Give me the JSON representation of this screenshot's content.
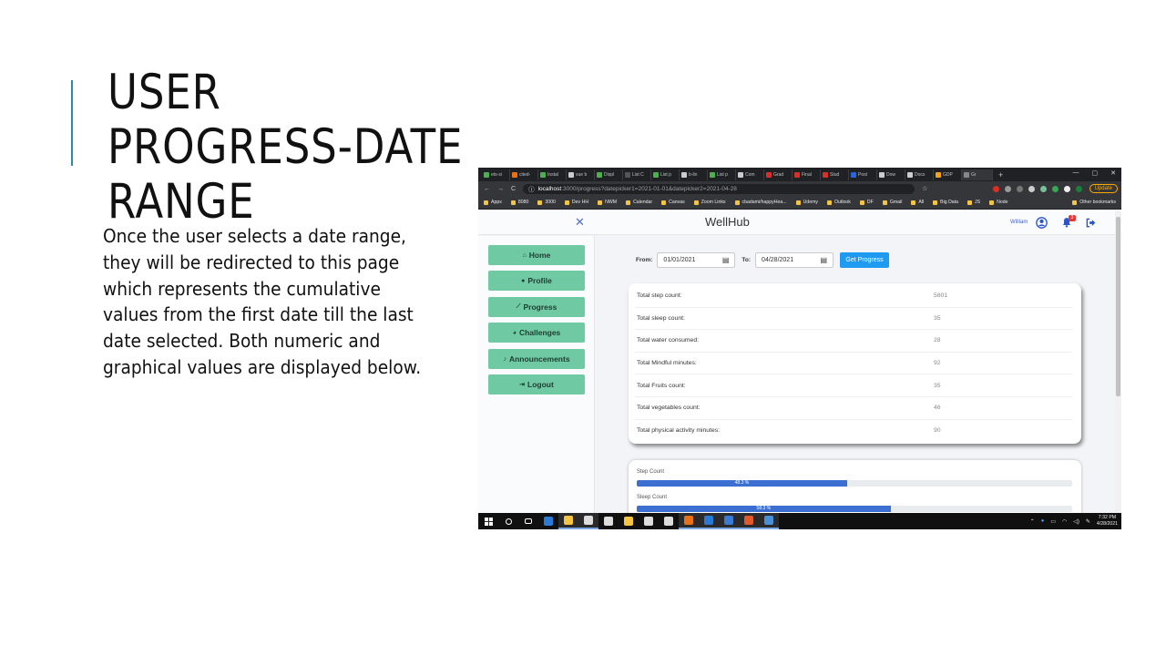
{
  "slide": {
    "title": "USER PROGRESS-DATE RANGE",
    "body": "Once the user selects a date range, they will be redirected to this page which represents the cumulative values from the first date till the last date selected. Both numeric and graphical values are displayed below."
  },
  "browser": {
    "tabs": [
      "ets-si",
      "cited-",
      "Instal",
      "vue b",
      "Displ",
      "List C",
      "List p",
      "b-lin",
      "List p",
      "Com",
      "Grad",
      "Final",
      "Stud",
      "Post",
      "Dow",
      "Docs",
      "GDP",
      "Gr"
    ],
    "url_host": "localhost",
    "url_path": ":3000/progress?datepicker1=2021-01-01&datepicker2=2021-04-28",
    "update_label": "Update",
    "bookmarks": [
      "Apps",
      "8080",
      "3000",
      "Dev HH",
      "NWM",
      "Calendar",
      "Canvas",
      "Zoom Links",
      "cbadami/happyHea...",
      "Udemy",
      "Outlook",
      "DF",
      "Gmail",
      "All",
      "Big Data",
      "JS",
      "Node"
    ],
    "other_bookmarks": "Other bookmarks"
  },
  "app": {
    "brand": "WellHub",
    "user_name": "William",
    "notification_count": "3",
    "nav": [
      {
        "label": "Home",
        "icon": "home-icon"
      },
      {
        "label": "Profile",
        "icon": "user-icon"
      },
      {
        "label": "Progress",
        "icon": "chart-line-icon"
      },
      {
        "label": "Challenges",
        "icon": "pie-chart-icon"
      },
      {
        "label": "Announcements",
        "icon": "bell-icon"
      },
      {
        "label": "Logout",
        "icon": "sign-out-icon"
      }
    ],
    "filter": {
      "from_label": "From:",
      "from_value": "01/01/2021",
      "to_label": "To:",
      "to_value": "04/28/2021",
      "button": "Get Progress"
    },
    "totals": [
      {
        "label": "Total step count:",
        "value": "5801"
      },
      {
        "label": "Total sleep count:",
        "value": "35"
      },
      {
        "label": "Total water consumed:",
        "value": "28"
      },
      {
        "label": "Total Mindful minutes:",
        "value": "92"
      },
      {
        "label": "Total Fruits count:",
        "value": "35"
      },
      {
        "label": "Total vegetables count:",
        "value": "46"
      },
      {
        "label": "Total physical activity minutes:",
        "value": "90"
      }
    ],
    "progress_bars": [
      {
        "label": "Step Count",
        "percent": 48.3,
        "text": "48.3 %"
      },
      {
        "label": "Sleep Count",
        "percent": 58.3,
        "text": "58.3 %"
      }
    ],
    "colors": {
      "nav": "#6fcaa3",
      "button": "#1e9bf0",
      "bar": "#3b6fd1",
      "accent": "#2e8ba8"
    }
  },
  "taskbar": {
    "time": "7:32 PM",
    "date": "4/28/2021"
  }
}
